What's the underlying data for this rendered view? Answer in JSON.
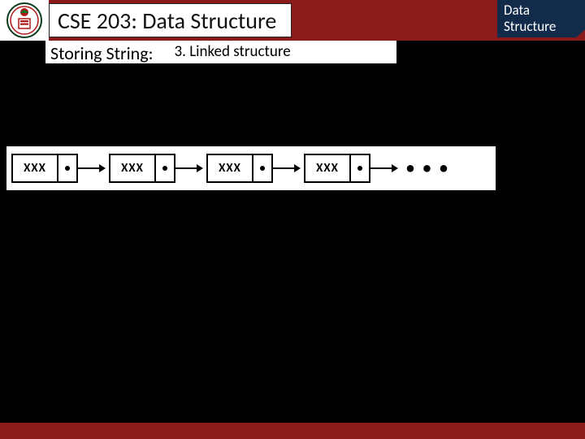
{
  "header": {
    "title": "CSE 203: Data Structure",
    "badge_line1": "Data",
    "badge_line2": "Structure"
  },
  "subhead": {
    "left": "Storing String:",
    "right": "3.   Linked structure"
  },
  "diagram": {
    "node_label": "XXX",
    "ellipsis": "• • •"
  }
}
